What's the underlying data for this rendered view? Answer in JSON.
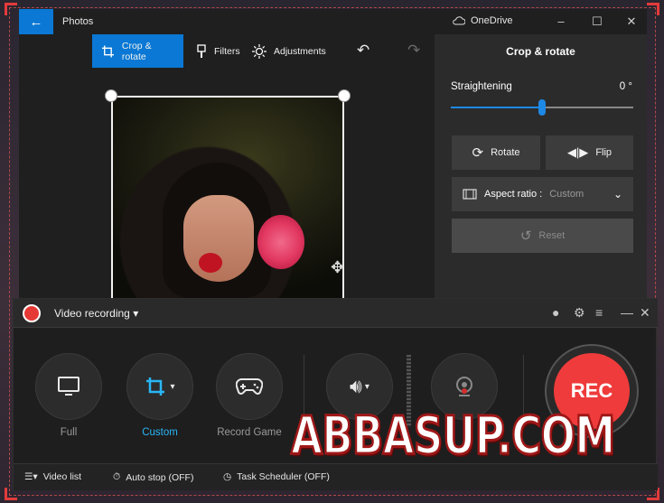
{
  "photos": {
    "app_title": "Photos",
    "onedrive_label": "OneDrive",
    "toolbar": {
      "crop_rotate": "Crop & rotate",
      "filters": "Filters",
      "adjustments": "Adjustments"
    },
    "panel": {
      "title": "Crop & rotate",
      "straightening_label": "Straightening",
      "straightening_value": "0 °",
      "straightening_fraction": 0.5,
      "rotate": "Rotate",
      "flip": "Flip",
      "aspect_label": "Aspect ratio :",
      "aspect_value": "Custom",
      "reset": "Reset"
    }
  },
  "recorder": {
    "mode": "Video recording",
    "buttons": {
      "full": "Full",
      "custom": "Custom",
      "record_game": "Record Game"
    },
    "rec_label": "REC",
    "footer": {
      "video_list": "Video list",
      "auto_stop": "Auto stop (OFF)",
      "task_scheduler": "Task Scheduler (OFF)"
    }
  },
  "watermark": "ABBASUP.COM",
  "colors": {
    "accent": "#0a78d4",
    "rec_red": "#ef3b3b",
    "custom_blue": "#29b6f6"
  }
}
